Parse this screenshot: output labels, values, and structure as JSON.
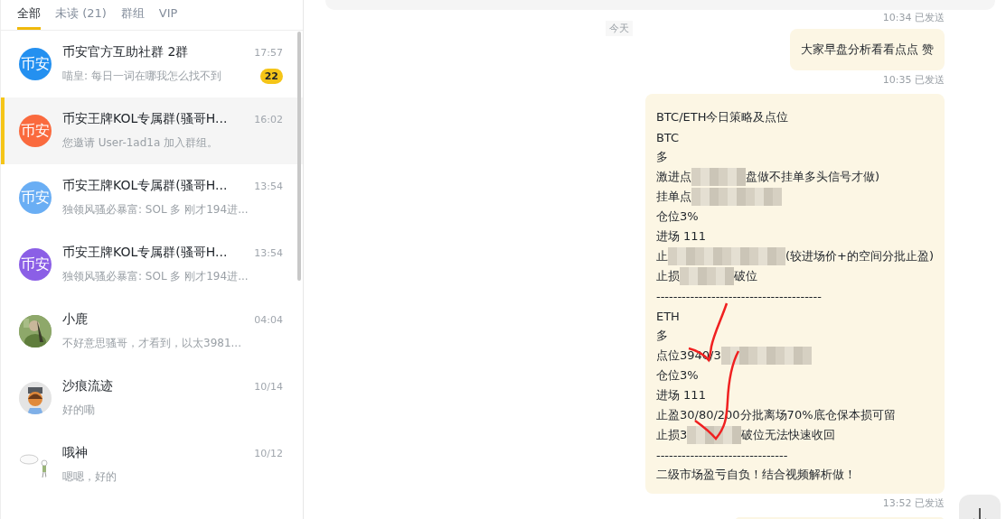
{
  "tabs": [
    {
      "label": "全部",
      "selected": true
    },
    {
      "label": "未读 (21)",
      "selected": false
    },
    {
      "label": "群组",
      "selected": false
    },
    {
      "label": "VIP",
      "selected": false
    }
  ],
  "chats": [
    {
      "avatar": {
        "kind": "text",
        "text": "币安",
        "color": "#2490f0"
      },
      "name": "币安官方互助社群 2群",
      "time": "17:57",
      "preview": "喵皇: 每日一词在哪我怎么找不到",
      "badge": "22",
      "selected": false
    },
    {
      "avatar": {
        "kind": "text",
        "text": "币安",
        "color": "#fa6a3e"
      },
      "name": "币安王牌KOL专属群(骚哥H...",
      "time": "16:02",
      "preview": "您邀请 User-1ad1a 加入群组。",
      "selected": true
    },
    {
      "avatar": {
        "kind": "text",
        "text": "币安",
        "color": "#6aaef4"
      },
      "name": "币安王牌KOL专属群(骚哥H...",
      "time": "13:54",
      "preview": "独领风骚必暴富: SOL 多 刚才194进...",
      "selected": false
    },
    {
      "avatar": {
        "kind": "text",
        "text": "币安",
        "color": "#8b5fe6"
      },
      "name": "币安王牌KOL专属群(骚哥H...",
      "time": "13:54",
      "preview": "独领风骚必暴富: SOL 多 刚才194进...",
      "selected": false
    },
    {
      "name": "小鹿",
      "time": "04:04",
      "preview": "不好意思骚哥，才看到，以太3981...",
      "selected": false
    },
    {
      "avatar": {
        "kind": "figure"
      },
      "name": "沙痕流迹",
      "time": "10/14",
      "preview": "好的嘞",
      "selected": false
    },
    {
      "avatar": {
        "kind": "sketch"
      },
      "name": "哦神",
      "time": "10/12",
      "preview": "嗯嗯，好的",
      "selected": false
    }
  ],
  "top_status": "10:34 已发送",
  "date_divider": "今天",
  "messages": [
    {
      "status": "10:35 已发送",
      "lines": [
        [
          {
            "kind": "text",
            "text": "大家早盘分析看看点点 赞"
          }
        ]
      ]
    },
    {
      "status": "13:52 已发送",
      "annotated": true,
      "lines": [
        [
          {
            "kind": "text",
            "text": "BTC/ETH今日策略及点位"
          }
        ],
        [
          {
            "kind": "text",
            "text": "BTC"
          }
        ],
        [
          {
            "kind": "text",
            "text": "多"
          }
        ],
        [
          {
            "kind": "text",
            "text": "激进点"
          },
          {
            "kind": "blur"
          },
          {
            "kind": "text",
            "text": "盘做不挂单多头信号才做)"
          }
        ],
        [
          {
            "kind": "text",
            "text": "挂单点"
          },
          {
            "kind": "blur"
          }
        ],
        [
          {
            "kind": "text",
            "text": "仓位3%"
          }
        ],
        [
          {
            "kind": "text",
            "text": "进场 111"
          }
        ],
        [
          {
            "kind": "text",
            "text": "止"
          },
          {
            "kind": "blur"
          },
          {
            "kind": "text",
            "text": "(较进场价+的空间分批止盈)"
          }
        ],
        [
          {
            "kind": "text",
            "text": "止损"
          },
          {
            "kind": "blur"
          },
          {
            "kind": "text",
            "text": "破位"
          }
        ],
        [
          {
            "kind": "text",
            "text": "---------------------------------------"
          }
        ],
        [
          {
            "kind": "text",
            "text": "ETH"
          }
        ],
        [
          {
            "kind": "text",
            "text": "多"
          }
        ],
        [
          {
            "kind": "text",
            "text": "点位3940/3"
          },
          {
            "kind": "blur"
          }
        ],
        [
          {
            "kind": "text",
            "text": "仓位3%"
          }
        ],
        [
          {
            "kind": "text",
            "text": "进场 111"
          }
        ],
        [
          {
            "kind": "text",
            "text": "止盈30/80/200分批离场70%底仓保本损可留"
          }
        ],
        [
          {
            "kind": "text",
            "text": "止损3"
          },
          {
            "kind": "blur"
          },
          {
            "kind": "text",
            "text": "破位无法快速收回"
          }
        ],
        [
          {
            "kind": "text",
            "text": "-------------------------------"
          }
        ],
        [
          {
            "kind": "text",
            "text": "二级市场盈亏自负！结合视频解析做！"
          }
        ]
      ]
    }
  ]
}
